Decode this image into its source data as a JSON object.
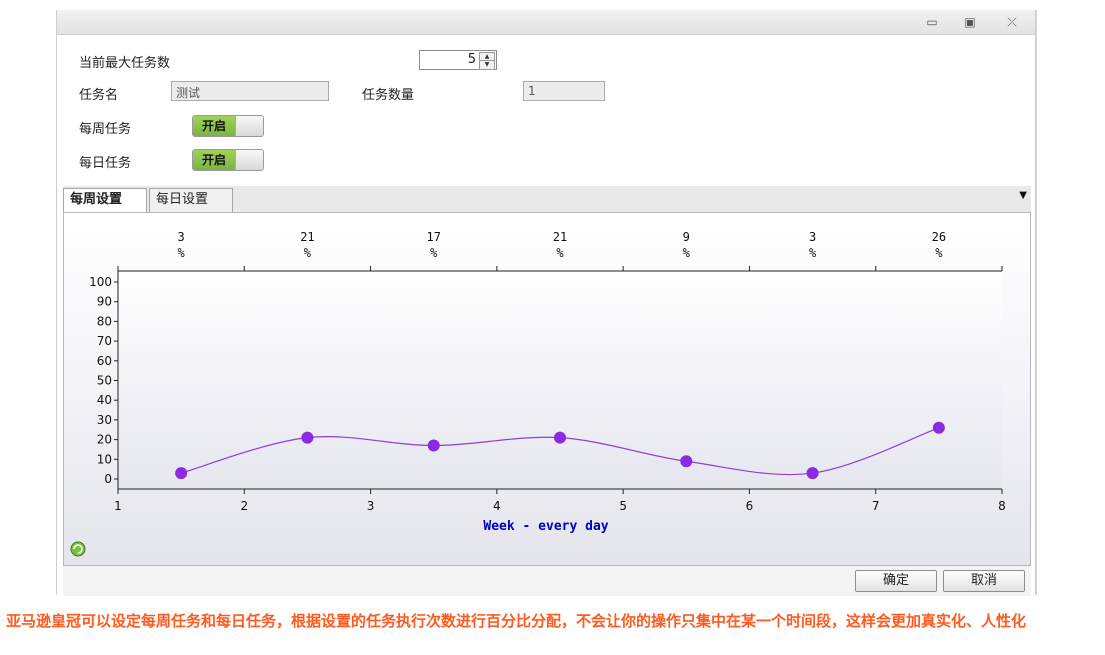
{
  "window": {
    "controls": {
      "minimize": "▭",
      "restore": "▣",
      "close": "⤫"
    }
  },
  "form": {
    "max_tasks_label": "当前最大任务数",
    "max_tasks_value": "5",
    "task_name_label": "任务名",
    "task_name_value": "测试",
    "task_count_label": "任务数量",
    "task_count_value": "1",
    "weekly_task_label": "每周任务",
    "weekly_toggle": "开启",
    "daily_task_label": "每日任务",
    "daily_toggle": "开启"
  },
  "tabs": {
    "weekly": "每周设置",
    "daily": "每日设置"
  },
  "chart_data": {
    "type": "line",
    "xlabel": "Week - every day",
    "x": [
      1.5,
      2.5,
      3.5,
      4.5,
      5.5,
      6.5,
      7.5
    ],
    "values": [
      3,
      21,
      17,
      21,
      9,
      3,
      26
    ],
    "top_labels": [
      {
        "value": "3",
        "unit": "%"
      },
      {
        "value": "21",
        "unit": "%"
      },
      {
        "value": "17",
        "unit": "%"
      },
      {
        "value": "21",
        "unit": "%"
      },
      {
        "value": "9",
        "unit": "%"
      },
      {
        "value": "3",
        "unit": "%"
      },
      {
        "value": "26",
        "unit": "%"
      }
    ],
    "xticks": [
      "1",
      "2",
      "3",
      "4",
      "5",
      "6",
      "7",
      "8"
    ],
    "yticks": [
      "0",
      "10",
      "20",
      "30",
      "40",
      "50",
      "60",
      "70",
      "80",
      "90",
      "100"
    ],
    "xlim": [
      1,
      8
    ],
    "ylim": [
      0,
      100
    ],
    "line_color": "#8a3fd6",
    "point_color": "#8a2be2",
    "xlabel_color": "#0000c8"
  },
  "buttons": {
    "ok": "确定",
    "cancel": "取消"
  },
  "caption": "亚马逊皇冠可以设定每周任务和每日任务，根据设置的任务执行次数进行百分比分配，不会让你的操作只集中在某一个时间段，这样会更加真实化、人性化",
  "colors": {
    "caption": "#ff5a1f",
    "toggle_on": "#7cb342"
  }
}
